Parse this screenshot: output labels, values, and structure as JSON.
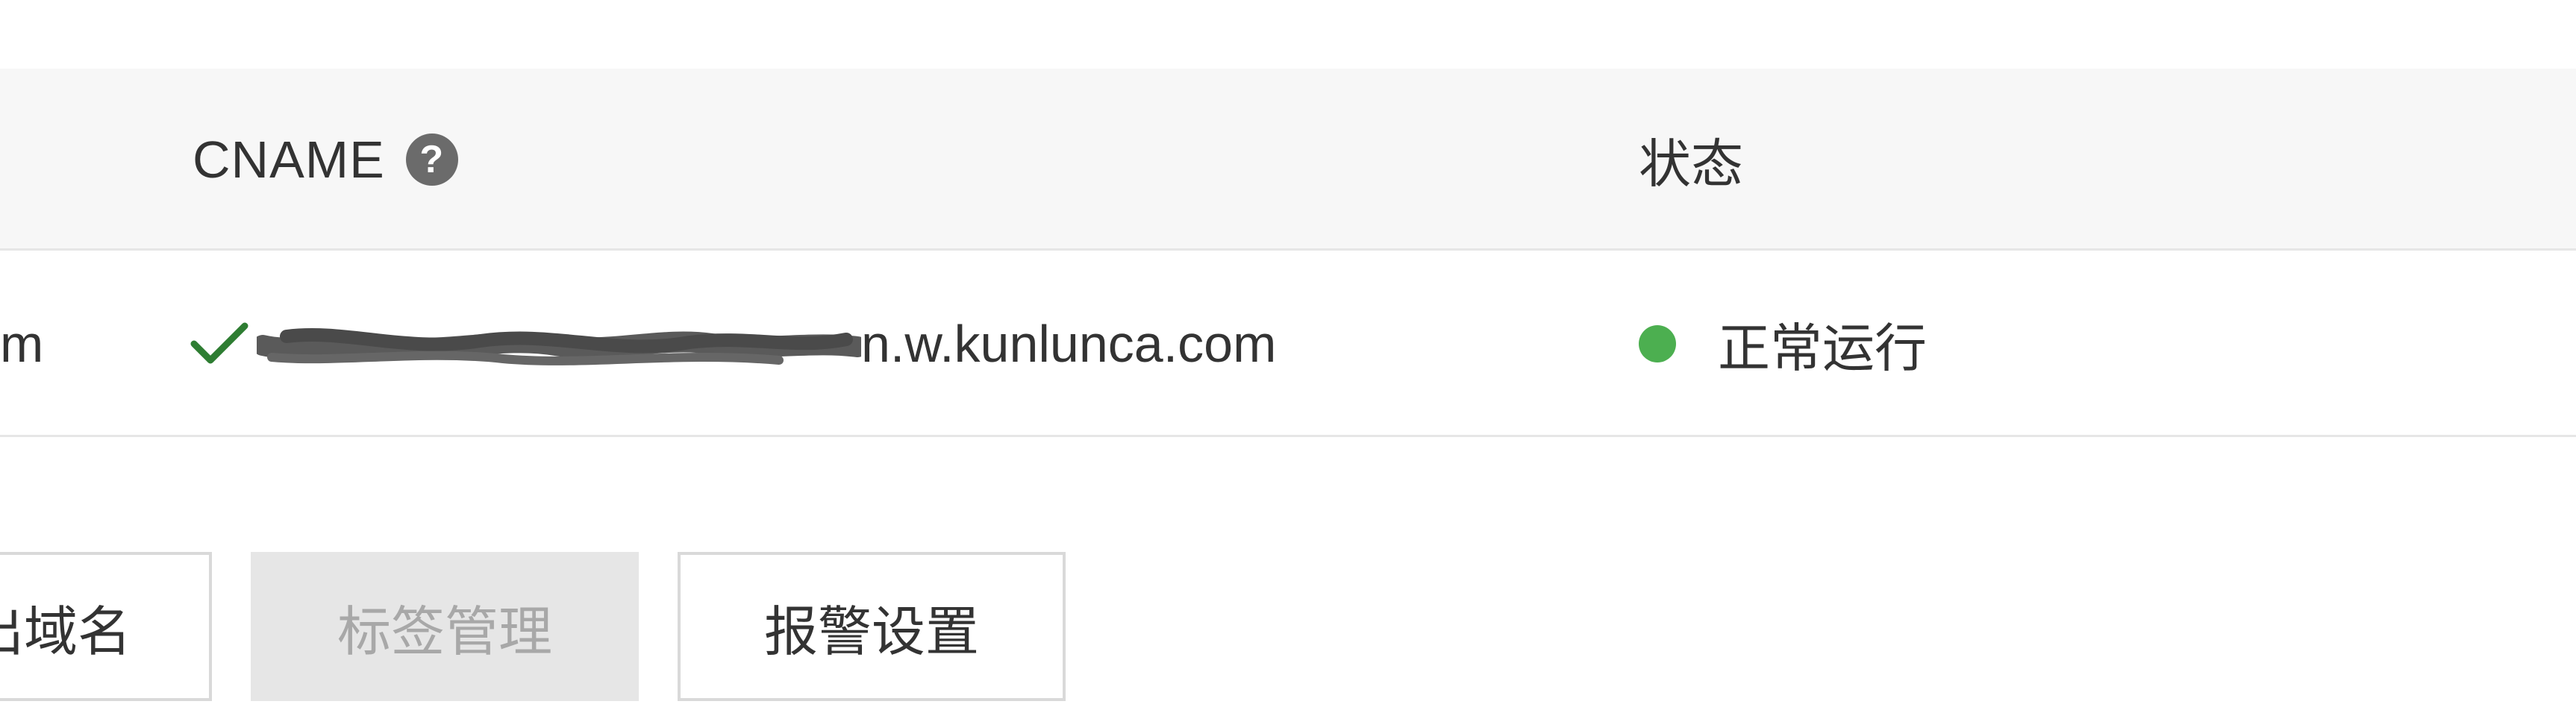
{
  "table": {
    "columns": {
      "cname": "CNAME",
      "status": "状态"
    },
    "row": {
      "domain_tail": "m",
      "cname_visible_suffix": "n.w.kunlunca.com",
      "status": "正常运行"
    }
  },
  "actions": {
    "export_label": "出域名",
    "tags_label": "标签管理",
    "alarm_label": "报警设置"
  },
  "colors": {
    "status_ok": "#4caf50",
    "check": "#2e7d32",
    "help_icon": "#6b6b6b"
  },
  "icons": [
    "help-icon",
    "check-icon",
    "status-dot-icon"
  ]
}
